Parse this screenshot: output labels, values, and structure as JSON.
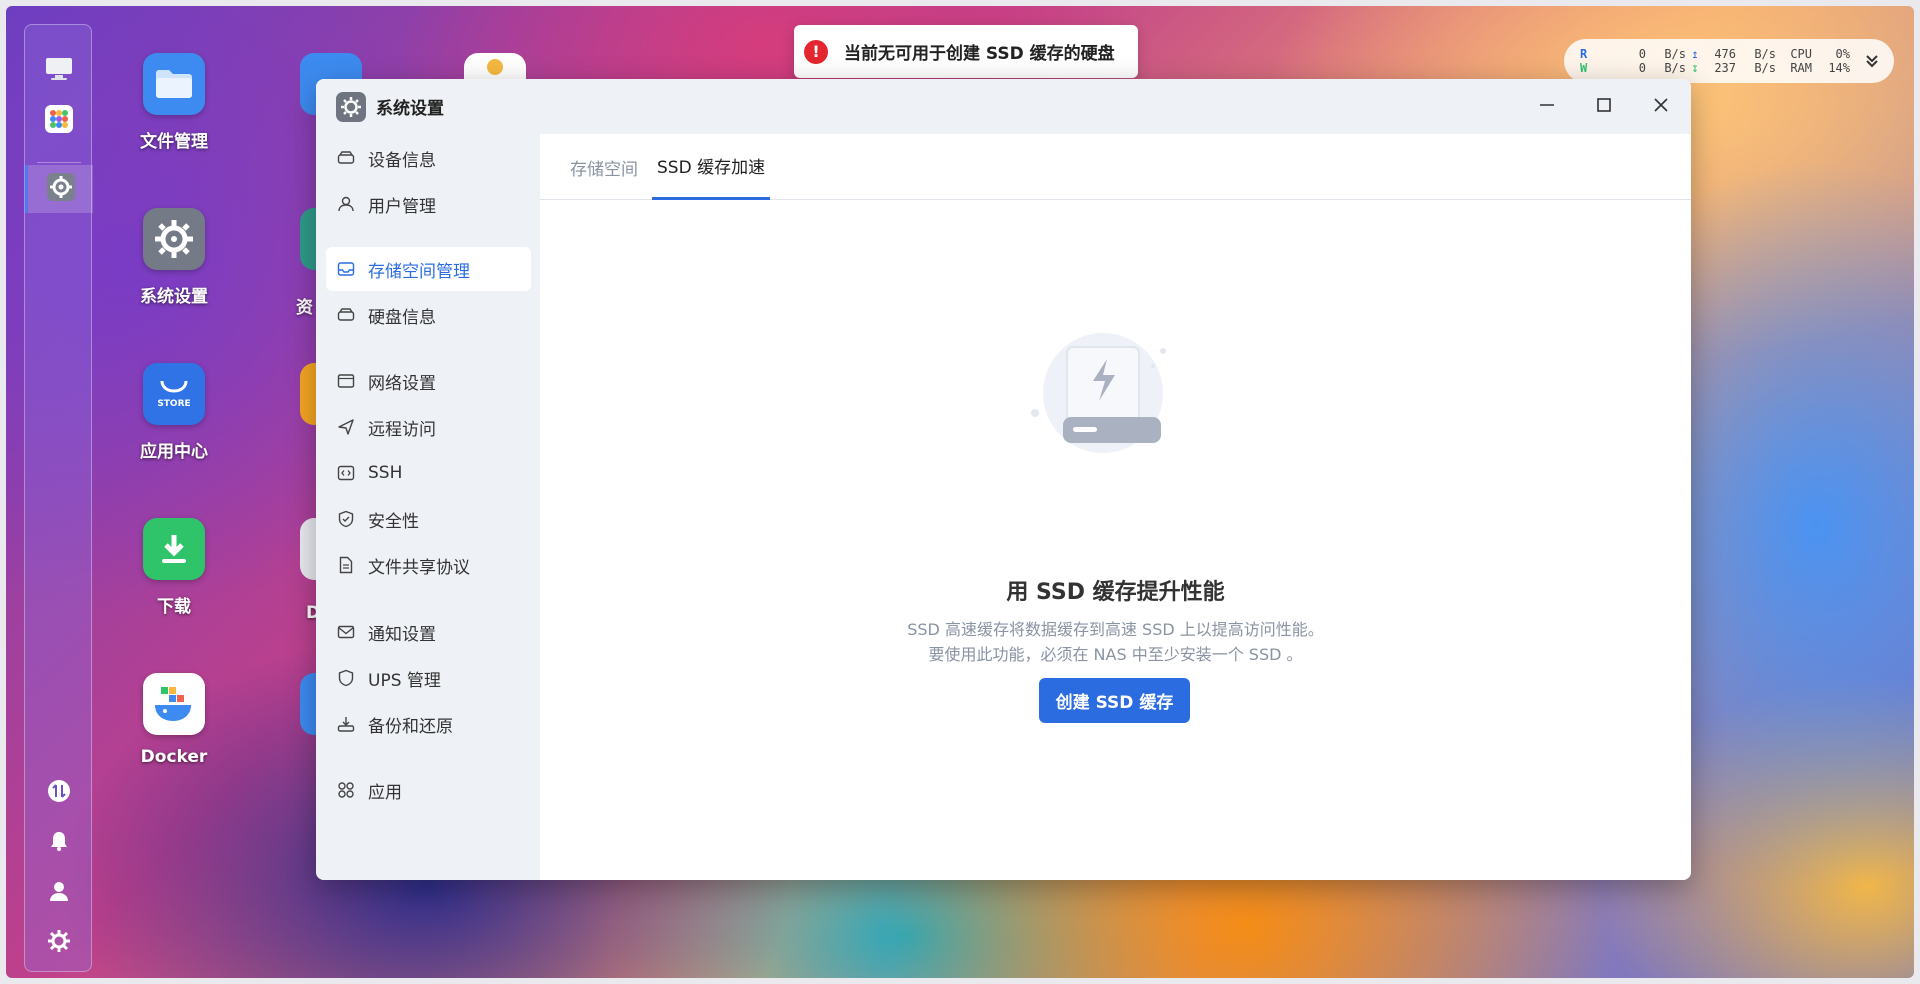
{
  "toast": {
    "message": "当前无可用于创建 SSD 缓存的硬盘",
    "icon": "error-icon",
    "color": "#e32630"
  },
  "monitor": {
    "read_label": "R",
    "write_label": "W",
    "read_speed": "0",
    "write_speed": "0",
    "upload_speed": "476",
    "download_speed": "237",
    "unit": "B/s",
    "cpu_label": "CPU",
    "cpu_value": "0%",
    "ram_label": "RAM",
    "ram_value": "14%"
  },
  "desktop": {
    "apps": [
      {
        "label": "文件管理",
        "icon": "folder-icon"
      },
      {
        "label": "系统设置",
        "icon": "gear-icon"
      },
      {
        "label": "应用中心",
        "icon": "store-icon",
        "badge": "STORE"
      },
      {
        "label": "下载",
        "icon": "download-icon"
      },
      {
        "label": "Docker",
        "icon": "docker-icon"
      }
    ],
    "partial_labels": [
      "资",
      "D"
    ]
  },
  "window": {
    "title": "系统设置",
    "sidebar": [
      {
        "label": "设备信息",
        "icon": "device-icon"
      },
      {
        "label": "用户管理",
        "icon": "user-icon"
      },
      {
        "label": "存储空间管理",
        "icon": "storage-icon",
        "active": true
      },
      {
        "label": "硬盘信息",
        "icon": "disk-icon"
      },
      {
        "label": "网络设置",
        "icon": "network-icon"
      },
      {
        "label": "远程访问",
        "icon": "send-icon"
      },
      {
        "label": "SSH",
        "icon": "ssh-icon"
      },
      {
        "label": "安全性",
        "icon": "shield-check-icon"
      },
      {
        "label": "文件共享协议",
        "icon": "document-icon"
      },
      {
        "label": "通知设置",
        "icon": "mail-icon"
      },
      {
        "label": "UPS 管理",
        "icon": "shield-icon"
      },
      {
        "label": "备份和还原",
        "icon": "backup-icon"
      },
      {
        "label": "应用",
        "icon": "apps-icon"
      }
    ],
    "tabs": [
      {
        "label": "存储空间",
        "active": false
      },
      {
        "label": "SSD 缓存加速",
        "active": true
      }
    ],
    "empty_state": {
      "title": "用 SSD 缓存提升性能",
      "desc_line1": "SSD 高速缓存将数据缓存到高速 SSD 上以提高访问性能。",
      "desc_line2": "要使用此功能，必须在 NAS 中至少安装一个 SSD 。",
      "button": "创建 SSD 缓存"
    },
    "accent": "#2b6de0"
  }
}
